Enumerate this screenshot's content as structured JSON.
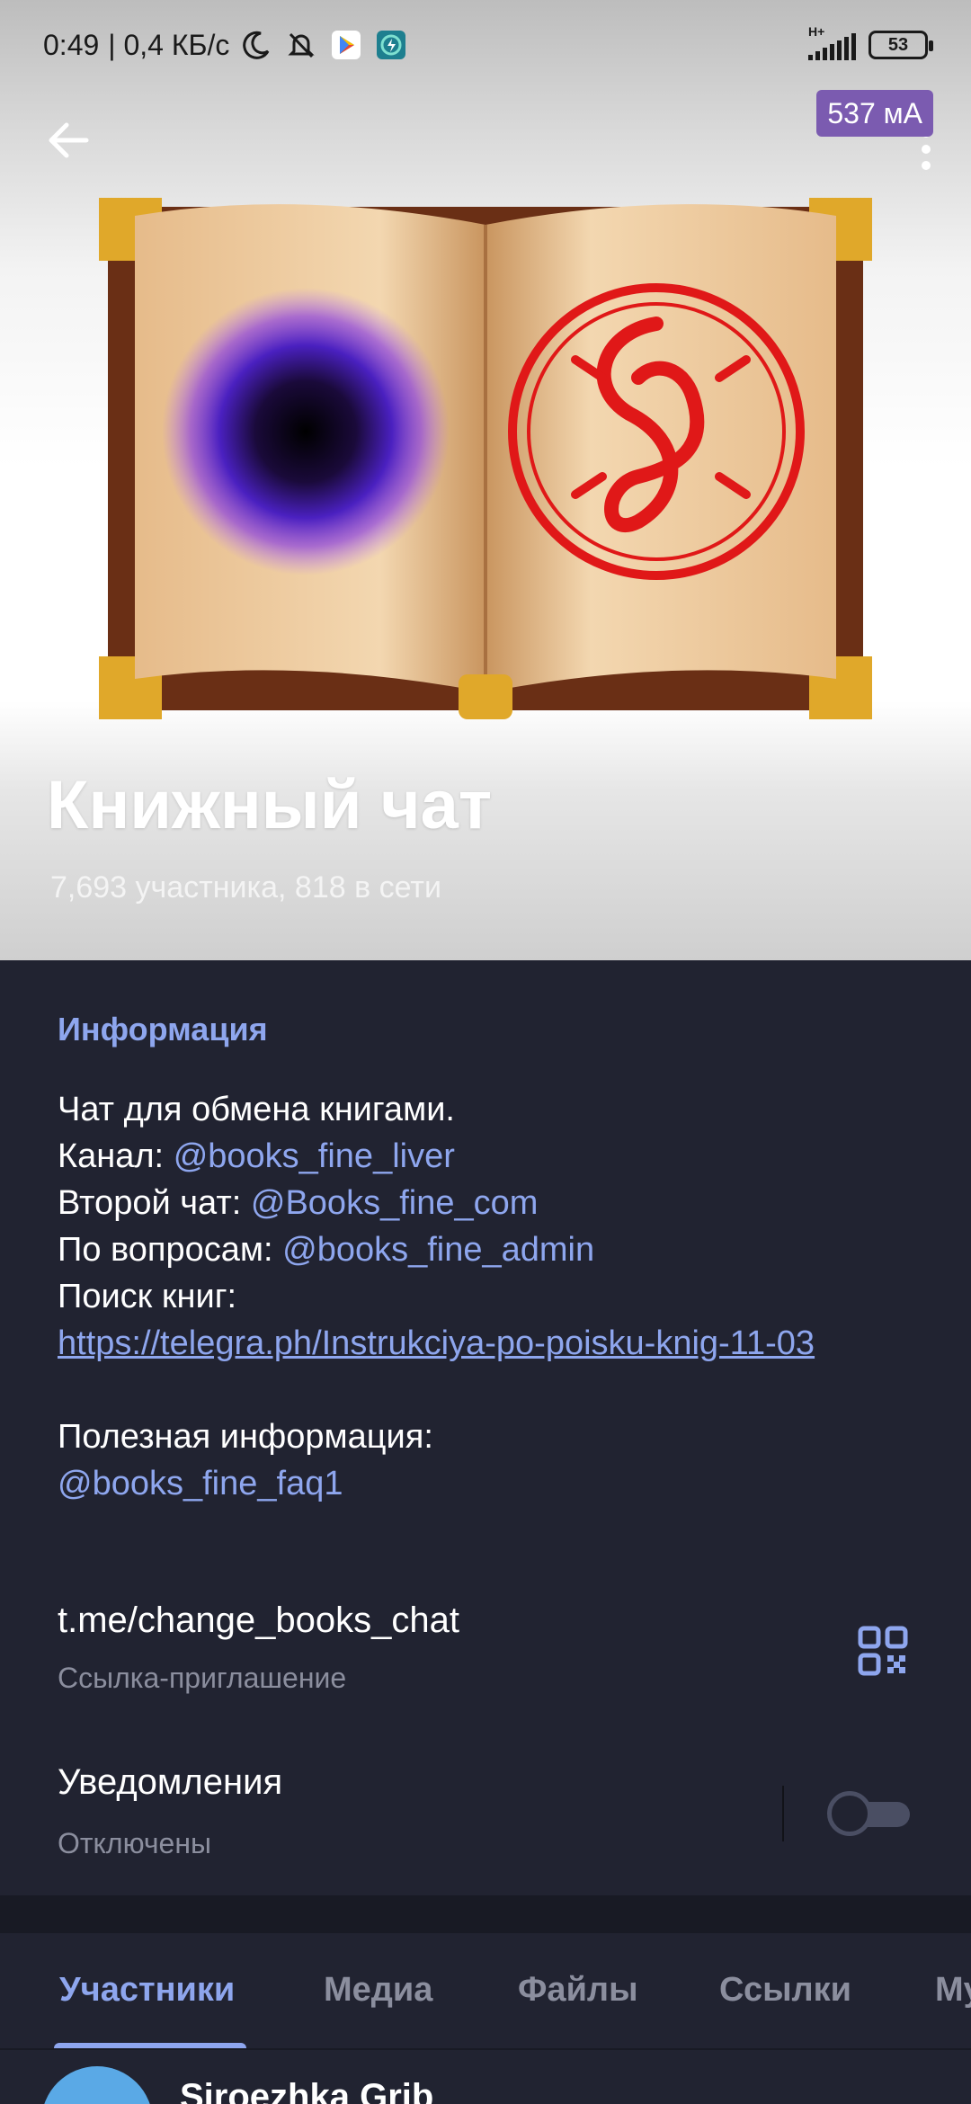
{
  "status_bar": {
    "time": "0:49",
    "speed": "| 0,4 КБ/с",
    "network": "H+",
    "battery": "53"
  },
  "header": {
    "current_badge": "537 мА",
    "title": "Книжный чат",
    "subtitle": "7,693 участника, 818 в сети"
  },
  "info": {
    "heading": "Информация",
    "line1": "Чат для обмена книгами.",
    "channel_label": "Канал: ",
    "channel_link": "@books_fine_liver",
    "second_chat_label": "Второй чат: ",
    "second_chat_link": "@Books_fine_com",
    "questions_label": "По вопросам: ",
    "questions_link": "@books_fine_admin",
    "search_label": "Поиск книг:",
    "search_url": "https://telegra.ph/Instrukciya-po-poisku-knig-11-03",
    "useful_label": "Полезная информация:",
    "useful_link": "@books_fine_faq1"
  },
  "invite": {
    "link": "t.me/change_books_chat",
    "caption": "Ссылка-приглашение"
  },
  "notifications": {
    "label": "Уведомления",
    "status": "Отключены",
    "enabled": false
  },
  "tabs": [
    {
      "label": "Участники",
      "active": true
    },
    {
      "label": "Медиа",
      "active": false
    },
    {
      "label": "Файлы",
      "active": false
    },
    {
      "label": "Ссылки",
      "active": false
    },
    {
      "label": "Му",
      "active": false
    }
  ],
  "members": [
    {
      "name": "Siroezhka Grib"
    }
  ],
  "colors": {
    "accent": "#8ea6ee",
    "background": "#212331",
    "badge": "#7b5bb0"
  }
}
